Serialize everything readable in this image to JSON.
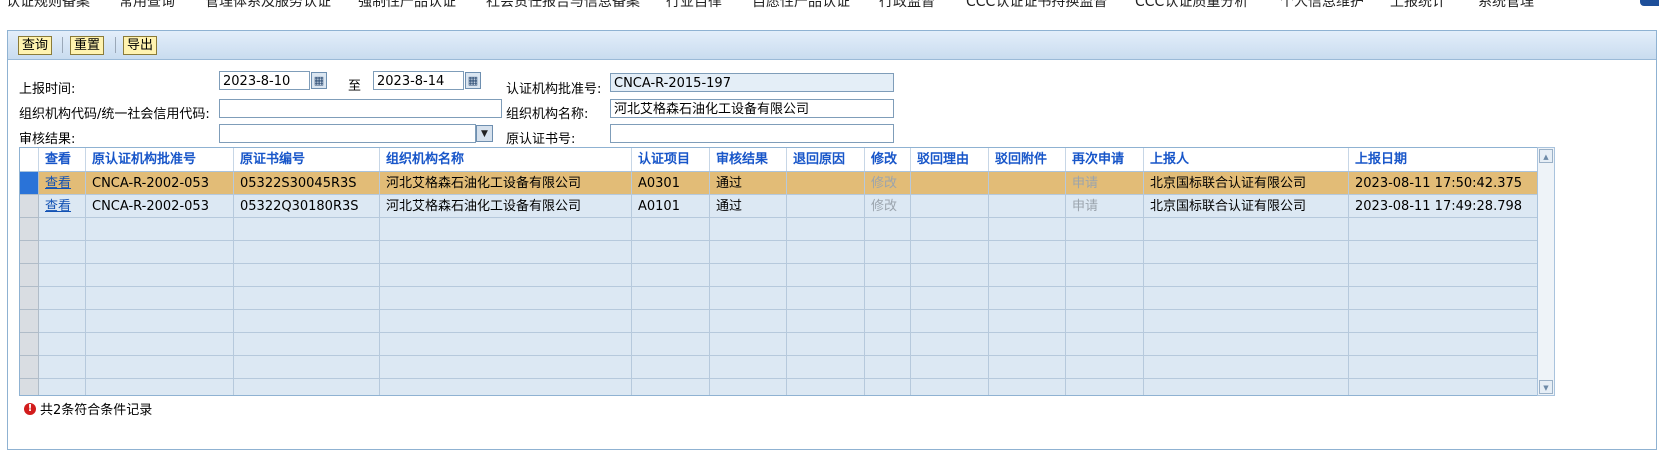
{
  "nav": [
    "认证规则备案",
    "常用查询",
    "管理体系及服务认证",
    "强制性产品认证",
    "社会责任报告与信息备案",
    "行业自律",
    "自愿性产品认证",
    "行政监督",
    "CCC认证证书持换监督",
    "CCC认证质量分析",
    "个人信息维护",
    "上报统计",
    "系统管理"
  ],
  "toolbar": {
    "query": "查询",
    "reset": "重置",
    "export": "导出"
  },
  "form": {
    "report_time_label": "上报时间:",
    "date_from": "2023-8-10",
    "to_label": "至",
    "date_to": "2023-8-14",
    "approval_no_label": "认证机构批准号:",
    "approval_no": "CNCA-R-2015-197",
    "org_code_label": "组织机构代码/统一社会信用代码:",
    "org_code": "",
    "org_name_label": "组织机构名称:",
    "org_name": "河北艾格森石油化工设备有限公司",
    "review_result_label": "审核结果:",
    "review_result": "",
    "orig_cert_no_label": "原认证书号:",
    "orig_cert_no": ""
  },
  "grid": {
    "headers": [
      "查看",
      "原认证机构批准号",
      "原证书编号",
      "组织机构名称",
      "认证项目",
      "审核结果",
      "退回原因",
      "修改",
      "驳回理由",
      "驳回附件",
      "再次申请",
      "上报人",
      "上报日期"
    ],
    "rows": [
      [
        "查看",
        "CNCA-R-2002-053",
        "05322S30045R3S",
        "河北艾格森石油化工设备有限公司",
        "A0301",
        "通过",
        "",
        "修改",
        "",
        "",
        "申请",
        "北京国标联合认证有限公司",
        "2023-08-11 17:50:42.375"
      ],
      [
        "查看",
        "CNCA-R-2002-053",
        "05322Q30180R3S",
        "河北艾格森石油化工设备有限公司",
        "A0101",
        "通过",
        "",
        "修改",
        "",
        "",
        "申请",
        "北京国标联合认证有限公司",
        "2023-08-11 17:49:28.798"
      ]
    ]
  },
  "status": "共2条符合条件记录",
  "colors": {
    "selected_row": "#e2bc77",
    "header_text": "#1856c9",
    "grid_bg": "#dce8f3"
  }
}
